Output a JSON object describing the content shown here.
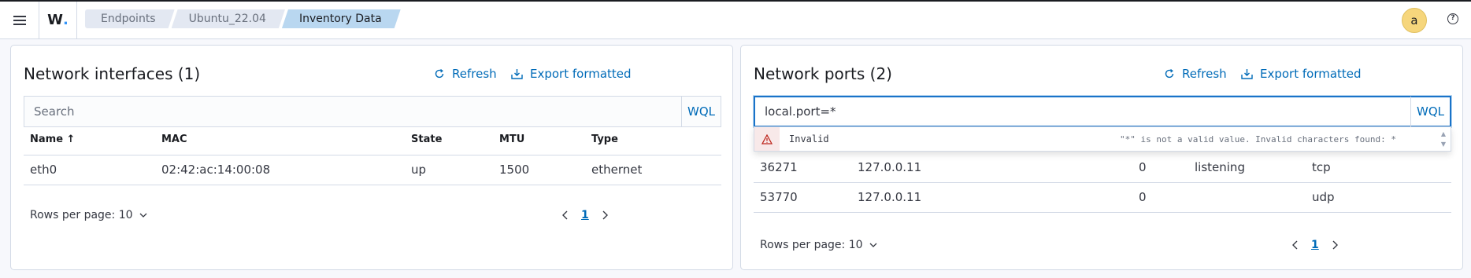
{
  "header": {
    "logo": "W",
    "breadcrumbs": [
      "Endpoints",
      "Ubuntu_22.04",
      "Inventory Data"
    ],
    "avatar": "a"
  },
  "network_interfaces": {
    "title": "Network interfaces (1)",
    "refresh_label": "Refresh",
    "export_label": "Export formatted",
    "search_placeholder": "Search",
    "wql_label": "WQL",
    "columns": [
      "Name",
      "MAC",
      "State",
      "MTU",
      "Type"
    ],
    "rows": [
      [
        "eth0",
        "02:42:ac:14:00:08",
        "up",
        "1500",
        "ethernet"
      ]
    ],
    "rows_per_page": "Rows per page: 10",
    "page": "1"
  },
  "network_ports": {
    "title": "Network ports (2)",
    "refresh_label": "Refresh",
    "export_label": "Export formatted",
    "search_value": "local.port=*",
    "wql_label": "WQL",
    "suggestion_label": "Invalid",
    "suggestion_message": "\"*\" is not a valid value. Invalid characters found: *",
    "rows": [
      [
        "36271",
        "127.0.0.11",
        "0",
        "listening",
        "tcp"
      ],
      [
        "53770",
        "127.0.0.11",
        "0",
        "",
        "udp"
      ]
    ],
    "rows_per_page": "Rows per page: 10",
    "page": "1"
  },
  "colors": {
    "accent": "#006bb8",
    "breadcrumb_active": "#b9d7f0",
    "avatar": "#f6d67c",
    "warning": "#bd271e"
  }
}
